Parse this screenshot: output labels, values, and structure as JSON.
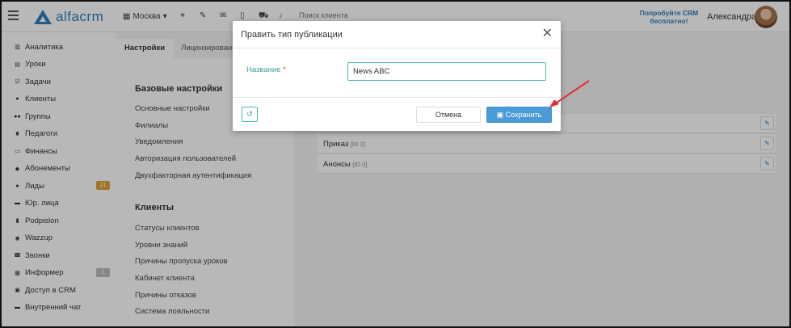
{
  "header": {
    "logo_text": "alfacrm",
    "branch": "Москва",
    "search_placeholder": "Поиск клиента",
    "promo": "Попробуйте CRM бесплатно!",
    "user_name": "Александра"
  },
  "sidebar": {
    "items": [
      {
        "label": "Аналитика",
        "icon": "chart-icon"
      },
      {
        "label": "Уроки",
        "icon": "calendar-icon"
      },
      {
        "label": "Задачи",
        "icon": "task-icon"
      },
      {
        "label": "Клиенты",
        "icon": "user-icon"
      },
      {
        "label": "Группы",
        "icon": "group-icon"
      },
      {
        "label": "Педагоги",
        "icon": "teacher-icon"
      },
      {
        "label": "Финансы",
        "icon": "money-icon"
      },
      {
        "label": "Абонементы",
        "icon": "tag-icon"
      },
      {
        "label": "Лиды",
        "icon": "lead-icon",
        "badge": "21",
        "badge_color": "#e0a33a"
      },
      {
        "label": "Юр. лица",
        "icon": "briefcase-icon"
      },
      {
        "label": "Podpislon",
        "icon": "document-icon"
      },
      {
        "label": "Wazzup",
        "icon": "whatsapp-icon"
      },
      {
        "label": "Звонки",
        "icon": "phone-icon"
      },
      {
        "label": "Информер",
        "icon": "list-icon",
        "badge": "2",
        "badge_color": "#bbbbbb"
      },
      {
        "label": "Доступ в CRM",
        "icon": "lock-icon"
      },
      {
        "label": "Внутренний чат",
        "icon": "chat-icon"
      }
    ]
  },
  "tabs": [
    {
      "label": "Настройки",
      "active": true
    },
    {
      "label": "Лицензирован",
      "active": false
    }
  ],
  "settings": {
    "base_title": "Базовые настройки",
    "base_links": [
      "Основные настройки",
      "Филиалы",
      "Уведомления",
      "Авторизация пользователей",
      "Двухфакторная аутентификация"
    ],
    "clients_title": "Клиенты",
    "clients_links": [
      "Статусы клиентов",
      "Уровни знаний",
      "Причины пропуска уроков",
      "Кабинет клиента",
      "Причины отказов",
      "Система лояльности"
    ]
  },
  "publication_types": [
    {
      "name": "Приказ",
      "id": "[ID 2]"
    },
    {
      "name": "Анонсы",
      "id": "[ID 3]"
    }
  ],
  "modal": {
    "title": "Править тип публикации",
    "field_label": "Название",
    "required_mark": "*",
    "field_value": "News ABC",
    "cancel": "Отмена",
    "save": "Сохранить"
  },
  "colors": {
    "accent": "#2f7fc1",
    "teal": "#3aa29a",
    "save_button": "#4a9ad6",
    "arrow": "#e03030"
  }
}
